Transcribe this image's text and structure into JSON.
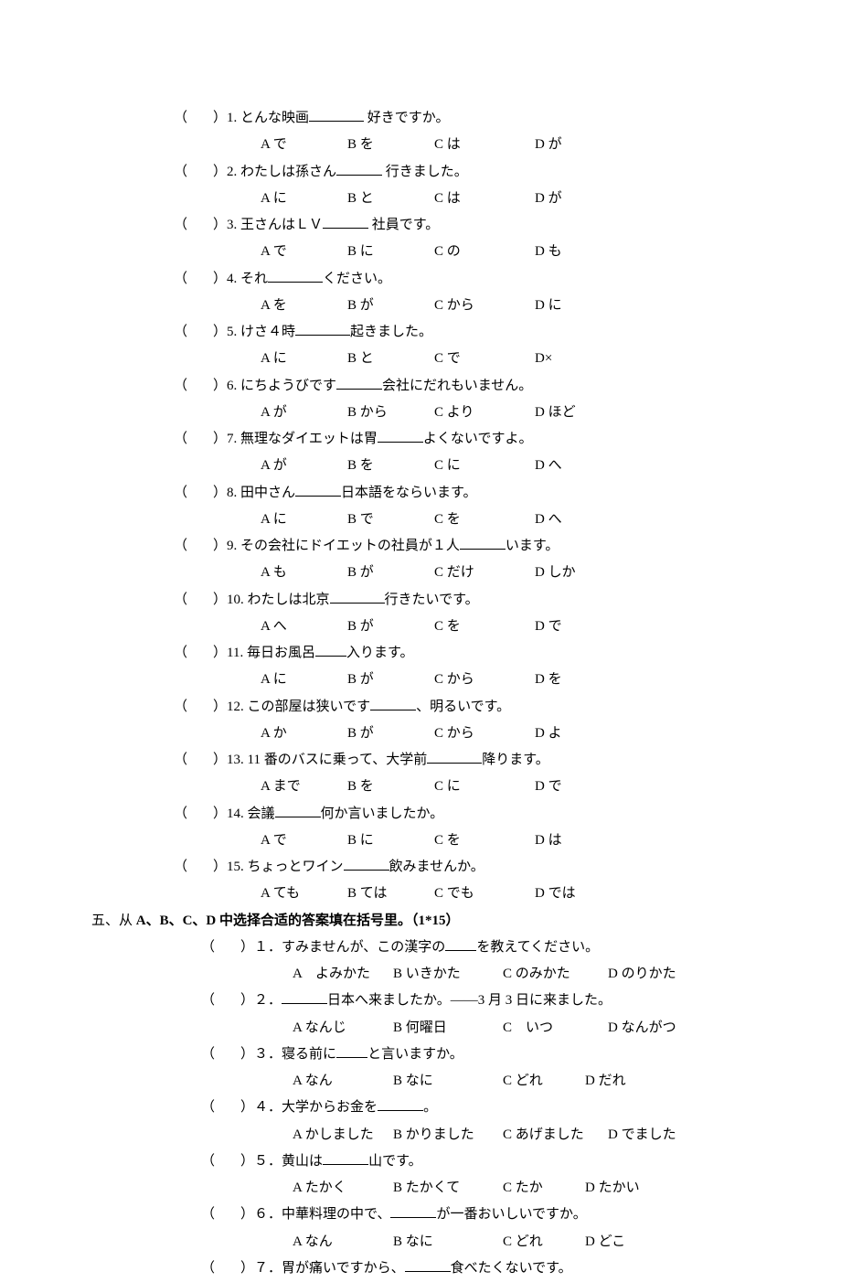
{
  "sectionA": {
    "q1": {
      "n": "1.",
      "pre": "とんな映画",
      "post": " 好きですか。",
      "a": "A で",
      "b": "B を",
      "c": "C は",
      "d": "D が",
      "bw": "w50"
    },
    "q2": {
      "n": "2.",
      "pre": "わたしは孫さん",
      "post": " 行きました。",
      "a": "A に",
      "b": "B と",
      "c": "C は",
      "d": "D が",
      "bw": "w40"
    },
    "q3": {
      "n": "3.",
      "pre": "王さんはＬＶ",
      "post": " 社員です。",
      "a": "A で",
      "b": "B に",
      "c": "C の",
      "d": "D も",
      "bw": "w40"
    },
    "q4": {
      "n": "4.",
      "pre": "それ",
      "post": "ください。",
      "a": "A を",
      "b": "B が",
      "c": "C から",
      "d": "D に",
      "bw": "w50"
    },
    "q5": {
      "n": "5.",
      "pre": "けさ４時",
      "post": "起きました。",
      "a": "A に",
      "b": "B と",
      "c": "C で",
      "d": "D×",
      "bw": "w50"
    },
    "q6": {
      "n": "6.",
      "pre": "にちようびです",
      "post": "会社にだれもいません。",
      "a": "A が",
      "b": "B から",
      "c": "C より",
      "d": "D ほど",
      "bw": "w40"
    },
    "q7": {
      "n": "7.",
      "pre": "無理なダイエットは胃",
      "post": "よくないですよ。",
      "a": "A が",
      "b": "B を",
      "c": "C に",
      "d": "D へ",
      "bw": "w40"
    },
    "q8": {
      "n": "8.",
      "pre": "田中さん",
      "post": "日本語をならいます。",
      "a": "A に",
      "b": "B で",
      "c": "C を",
      "d": "D へ",
      "bw": "w40"
    },
    "q9": {
      "n": "9.",
      "pre": "その会社にドイエットの社員が１人",
      "post": "います。",
      "a": "A も",
      "b": "B が",
      "c": "C だけ",
      "d": "D しか",
      "bw": "w40"
    },
    "q10": {
      "n": "10.",
      "pre": "わたしは北京",
      "post": "行きたいです。",
      "a": "A へ",
      "b": "B が",
      "c": "C を",
      "d": "D で",
      "bw": "w50"
    },
    "q11": {
      "n": "11.",
      "pre": "毎日お風呂",
      "post": "入ります。",
      "a": "A に",
      "b": "B が",
      "c": "C から",
      "d": "D を",
      "bw": "w25"
    },
    "q12": {
      "n": "12.",
      "pre": "この部屋は狭いです",
      "post": "、明るいです。",
      "a": "A か",
      "b": "B が",
      "c": "C から",
      "d": "D よ",
      "bw": "w40"
    },
    "q13": {
      "n": "13.",
      "pre": "11 番のバスに乗って、大学前",
      "post": "降ります。",
      "a": "A まで",
      "b": "B を",
      "c": "C に",
      "d": "D で",
      "bw": "w50"
    },
    "q14": {
      "n": "14.",
      "pre": "会議",
      "post": "何か言いましたか。",
      "a": "A で",
      "b": "B に",
      "c": "C を",
      "d": "D は",
      "bw": "w40"
    },
    "q15": {
      "n": "15.",
      "pre": "ちょっとワイン",
      "post": "飲みませんか。",
      "a": "A ても",
      "b": "B ては",
      "c": "C でも",
      "d": "D では",
      "bw": "w40"
    }
  },
  "sectionBTitle": {
    "prefix": "五、从 ",
    "abcd": "A、B、C、D",
    "mid": " 中选择合适的答案填在括号里。（",
    "pts": "1*15",
    "suffix": "）"
  },
  "sectionB": {
    "q1": {
      "n": "１．",
      "pre": "すみませんが、この漢字の",
      "post": "を教えてください。",
      "a": "A　よみかた",
      "b": "B いきかた",
      "c": "C のみかた",
      "d": "D のりかた",
      "bw": "w25"
    },
    "q2": {
      "n": "２．",
      "pre": "",
      "post": "日本へ来ましたか。——3 月 3 日に来ました。",
      "a": "A なんじ",
      "b": "B 何曜日",
      "c": "C　いつ",
      "d": "D なんがつ",
      "bw": "w40"
    },
    "q3": {
      "n": "３．",
      "pre": "寝る前に",
      "post": "と言いますか。",
      "a": "A なん",
      "b": "B なに",
      "c": "C どれ",
      "d": "D だれ",
      "bw": "w25"
    },
    "q4": {
      "n": "４．",
      "pre": "大学からお金を",
      "post": "。",
      "a": "A かしました",
      "b": "B かりました",
      "c": "C あげました",
      "d": "D でました",
      "bw": "w40"
    },
    "q5": {
      "n": "５．",
      "pre": "黄山は",
      "post": "山です。",
      "a": "A たかく",
      "b": "B たかくて",
      "c": "C たか",
      "d": "D たかい",
      "bw": "w40"
    },
    "q6": {
      "n": "６．",
      "pre": "中華料理の中で、",
      "post": "が一番おいしいですか。",
      "a": "A なん",
      "b": "B なに",
      "c": "C どれ",
      "d": "D どこ",
      "bw": "w40"
    },
    "q7": {
      "n": "７．",
      "pre": "胃が痛いですから、",
      "post": "食べたくないです。",
      "bw": "w40"
    }
  }
}
